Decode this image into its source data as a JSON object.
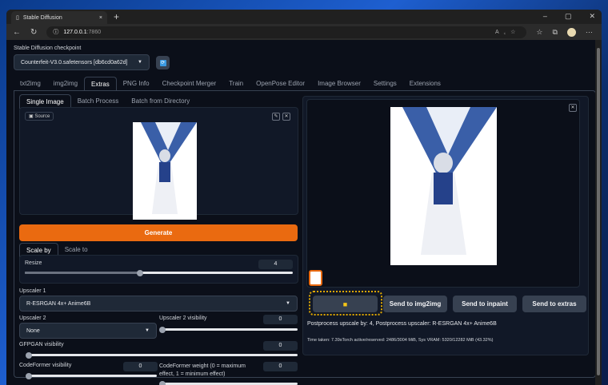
{
  "browser": {
    "tab_title": "Stable Diffusion",
    "url_host": "127.0.0.1",
    "url_port": ":7860"
  },
  "checkpoint": {
    "label": "Stable Diffusion checkpoint",
    "value": "Counterfeit-V3.0.safetensors [db6cd0a62d]"
  },
  "tabs": [
    "txt2img",
    "img2img",
    "Extras",
    "PNG Info",
    "Checkpoint Merger",
    "Train",
    "OpenPose Editor",
    "Image Browser",
    "Settings",
    "Extensions"
  ],
  "subtabs": [
    "Single Image",
    "Batch Process",
    "Batch from Directory"
  ],
  "source_label": "Source",
  "generate_label": "Generate",
  "scale_tabs": [
    "Scale by",
    "Scale to"
  ],
  "resize": {
    "label": "Resize",
    "value": "4",
    "fraction": 0.43
  },
  "upscaler1": {
    "label": "Upscaler 1",
    "value": "R-ESRGAN 4x+ Anime6B"
  },
  "upscaler2": {
    "label": "Upscaler 2",
    "value": "None"
  },
  "upscaler2_vis": {
    "label": "Upscaler 2 visibility",
    "value": "0"
  },
  "gfpgan": {
    "label": "GFPGAN visibility",
    "value": "0"
  },
  "codeformer_vis": {
    "label": "CodeFormer visibility",
    "value": "0"
  },
  "codeformer_weight": {
    "label": "CodeFormer weight (0 = maximum effect, 1 = minimum effect)",
    "value": "0"
  },
  "output": {
    "buttons": [
      "Send to img2img",
      "Send to inpaint",
      "Send to extras"
    ],
    "info": "Postprocess upscale by: 4, Postprocess upscaler: R-ESRGAN 4x+ Anime6B",
    "time": "Time taken: 7.39sTorch active/reserved: 2486/3004 MiB, Sys VRAM: 5320/12282 MiB (43.32%)"
  }
}
